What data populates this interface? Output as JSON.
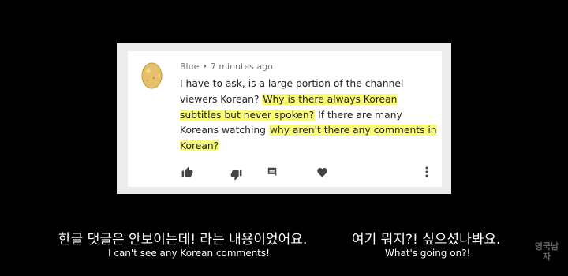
{
  "comment": {
    "author": "Blue",
    "separator": "•",
    "time": "7 minutes ago",
    "segments": [
      {
        "text": "I have to ask, is a large portion of the channel viewers Korean? ",
        "highlight": false
      },
      {
        "text": "Why is there always Korean subtitles but never spoken?",
        "highlight": true
      },
      {
        "text": " If there are many Koreans watching ",
        "highlight": false
      },
      {
        "text": "why aren't there any comments in Korean?",
        "highlight": true
      }
    ],
    "highlight_color": "#fbfb7a",
    "actions": [
      {
        "name": "like-icon"
      },
      {
        "name": "dislike-icon"
      },
      {
        "name": "reply-icon"
      },
      {
        "name": "heart-icon"
      },
      {
        "name": "more-icon"
      }
    ]
  },
  "subtitles": {
    "left_ko": "한글 댓글은 안보이는데! 라는 내용이었어요.",
    "left_en": "I can't see any Korean comments!",
    "right_ko": "여기 뭐지?! 싶으셨나봐요.",
    "right_en": "What's going on?!"
  },
  "watermark": "영국남자"
}
